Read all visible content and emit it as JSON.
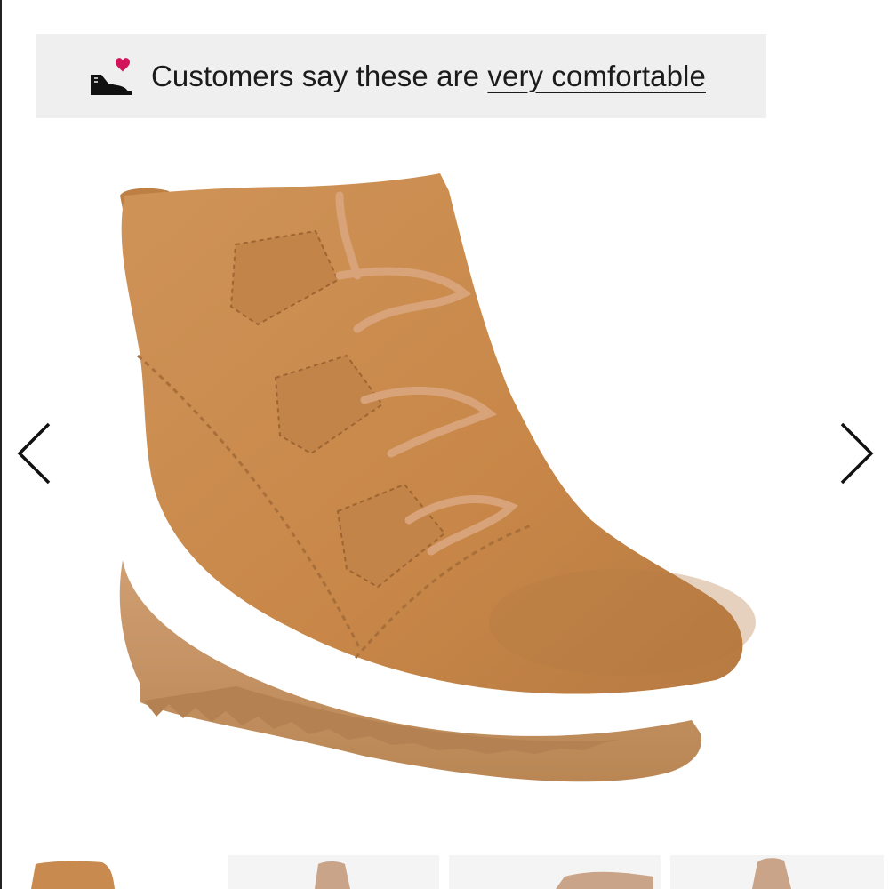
{
  "banner": {
    "text_prefix": "Customers say these are ",
    "link_text": "very comfortable",
    "icon": "sneaker-heart-icon",
    "background": "#efefef",
    "heart_color": "#d2145a"
  },
  "gallery": {
    "product_image": "ankle-wedge-boot-image",
    "prev_icon": "chevron-left-icon",
    "next_icon": "chevron-right-icon",
    "boot_color": "#c98a4f",
    "sole_color": "#c99669",
    "thumbnails": [
      {
        "icon": "boot-thumbnail-1"
      },
      {
        "icon": "boot-thumbnail-2"
      },
      {
        "icon": "boot-thumbnail-3"
      },
      {
        "icon": "boot-thumbnail-4"
      }
    ]
  }
}
